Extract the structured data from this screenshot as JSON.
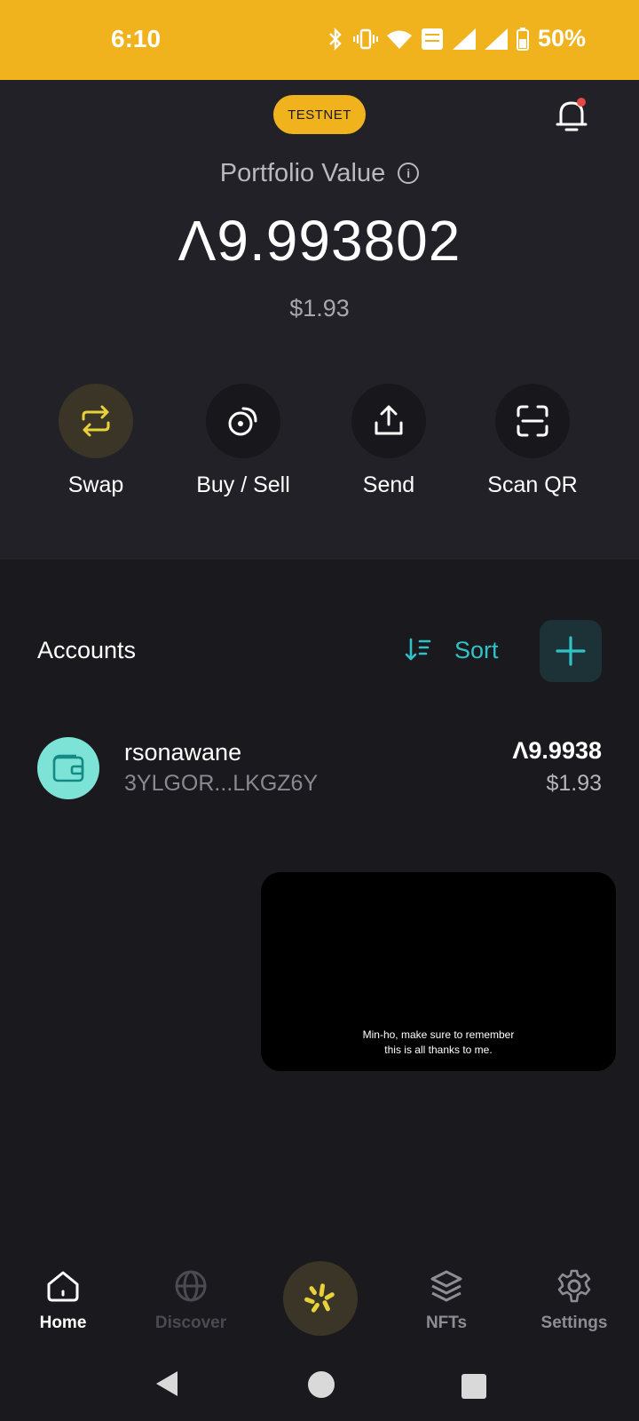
{
  "status_bar": {
    "time": "6:10",
    "battery": "50%",
    "icons": [
      "bluetooth-icon",
      "vibrate-icon",
      "wifi-icon",
      "volte-icon",
      "signal-icon",
      "signal-r-icon",
      "battery-icon"
    ]
  },
  "header": {
    "network_badge": "TESTNET",
    "notification_icon": "bell-icon"
  },
  "portfolio": {
    "label": "Portfolio Value",
    "amount": "Ʌ9.993802",
    "usd_value": "$1.93"
  },
  "actions": [
    {
      "label": "Swap",
      "icon": "swap-icon"
    },
    {
      "label": "Buy / Sell",
      "icon": "buy-sell-icon"
    },
    {
      "label": "Send",
      "icon": "share-icon"
    },
    {
      "label": "Scan QR",
      "icon": "scan-qr-icon"
    }
  ],
  "accounts": {
    "title": "Accounts",
    "sort_label": "Sort",
    "items": [
      {
        "name": "rsonawane",
        "address": "3YLGOR...LKGZ6Y",
        "balance": "Ʌ9.9938",
        "usd": "$1.93"
      }
    ]
  },
  "video_overlay": {
    "caption_line1": "Min-ho, make sure to remember",
    "caption_line2": "this is all thanks to me."
  },
  "bottom_nav": [
    {
      "label": "Home",
      "icon": "home-icon",
      "active": true
    },
    {
      "label": "Discover",
      "icon": "globe-icon",
      "active": false
    },
    {
      "label": "",
      "icon": "pera-logo-icon",
      "active": false
    },
    {
      "label": "NFTs",
      "icon": "layers-icon",
      "active": false
    },
    {
      "label": "Settings",
      "icon": "gear-icon",
      "active": false
    }
  ],
  "colors": {
    "accent_yellow": "#f0b31e",
    "accent_teal": "#2fc2c8",
    "background": "#1a1a1e",
    "surface": "#222127"
  }
}
